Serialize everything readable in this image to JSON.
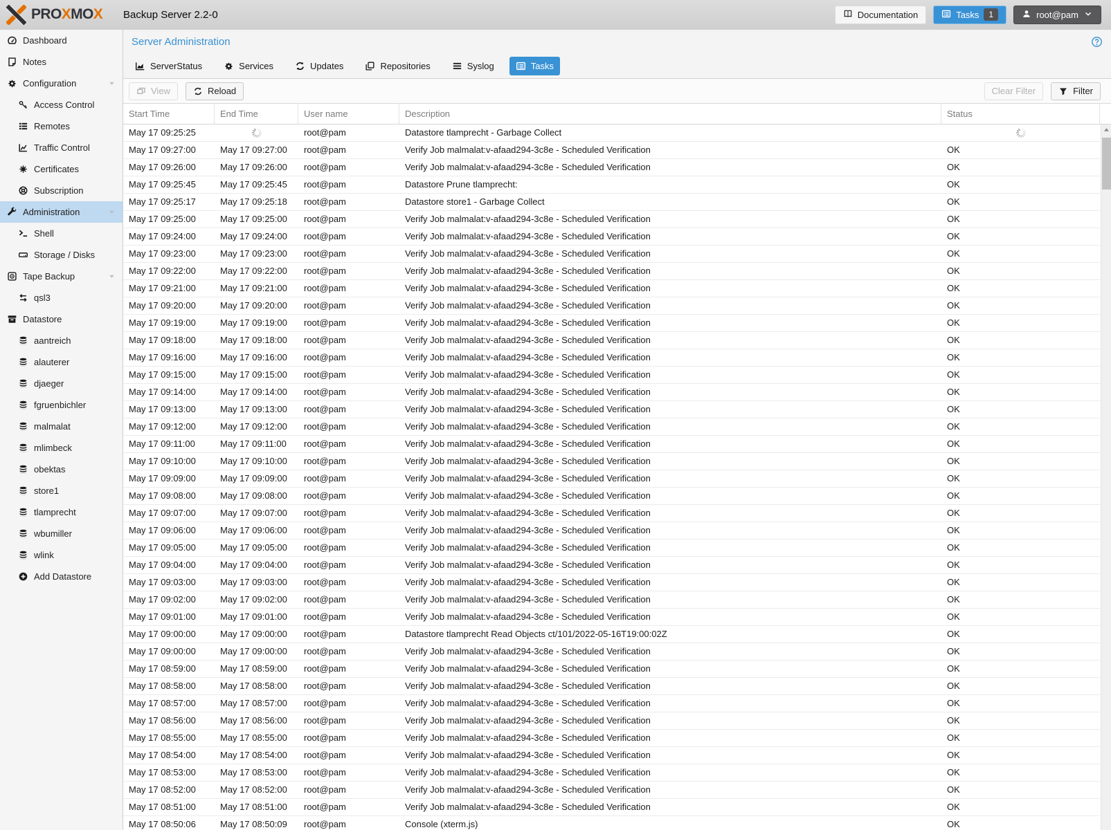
{
  "topbar": {
    "brand_segments": [
      {
        "text": "PRO",
        "color": "dark"
      },
      {
        "text": "X",
        "color": "orange"
      },
      {
        "text": "MO",
        "color": "dark"
      },
      {
        "text": "X",
        "color": "orange"
      }
    ],
    "product_title": "Backup Server 2.2-0",
    "documentation_label": "Documentation",
    "documentation_icon": "book-icon",
    "tasks_label": "Tasks",
    "tasks_icon": "list-alt-icon",
    "tasks_badge": "1",
    "user_label": "root@pam",
    "user_icon": "user-icon",
    "user_caret_icon": "chevron-down-icon",
    "colors": {
      "accent_blue": "#3892d4",
      "brand_orange": "#e57000"
    }
  },
  "sidebar": {
    "items": [
      {
        "label": "Dashboard",
        "icon": "dashboard-icon",
        "level": 0
      },
      {
        "label": "Notes",
        "icon": "note-icon",
        "level": 0
      },
      {
        "label": "Configuration",
        "icon": "gears-icon",
        "level": 0,
        "expandable": true
      },
      {
        "label": "Access Control",
        "icon": "key-icon",
        "level": 1
      },
      {
        "label": "Remotes",
        "icon": "remotes-icon",
        "level": 1
      },
      {
        "label": "Traffic Control",
        "icon": "traffic-chart-icon",
        "level": 1
      },
      {
        "label": "Certificates",
        "icon": "certificate-icon",
        "level": 1
      },
      {
        "label": "Subscription",
        "icon": "support-icon",
        "level": 1
      },
      {
        "label": "Administration",
        "icon": "wrench-icon",
        "level": 0,
        "expandable": true,
        "selected": true
      },
      {
        "label": "Shell",
        "icon": "terminal-icon",
        "level": 1
      },
      {
        "label": "Storage / Disks",
        "icon": "hdd-icon",
        "level": 1
      },
      {
        "label": "Tape Backup",
        "icon": "tape-icon",
        "level": 0,
        "expandable": true
      },
      {
        "label": "qsl3",
        "icon": "exchange-icon",
        "level": 1
      },
      {
        "label": "Datastore",
        "icon": "datastore-icon",
        "level": 0
      },
      {
        "label": "aantreich",
        "icon": "database-icon",
        "level": 1
      },
      {
        "label": "alauterer",
        "icon": "database-icon",
        "level": 1
      },
      {
        "label": "djaeger",
        "icon": "database-icon",
        "level": 1
      },
      {
        "label": "fgruenbichler",
        "icon": "database-icon",
        "level": 1
      },
      {
        "label": "malmalat",
        "icon": "database-icon",
        "level": 1
      },
      {
        "label": "mlimbeck",
        "icon": "database-icon",
        "level": 1
      },
      {
        "label": "obektas",
        "icon": "database-icon",
        "level": 1
      },
      {
        "label": "store1",
        "icon": "database-icon",
        "level": 1
      },
      {
        "label": "tlamprecht",
        "icon": "database-icon",
        "level": 1
      },
      {
        "label": "wbumiller",
        "icon": "database-icon",
        "level": 1
      },
      {
        "label": "wlink",
        "icon": "database-icon",
        "level": 1
      },
      {
        "label": "Add Datastore",
        "icon": "plus-circle-icon",
        "level": 1
      }
    ]
  },
  "content": {
    "title": "Server Administration",
    "help_icon": "question-circle-icon",
    "tabs": [
      {
        "label": "ServerStatus",
        "icon": "chart-area-icon",
        "active": false
      },
      {
        "label": "Services",
        "icon": "gears-icon",
        "active": false
      },
      {
        "label": "Updates",
        "icon": "refresh-icon",
        "active": false
      },
      {
        "label": "Repositories",
        "icon": "copy-icon",
        "active": false
      },
      {
        "label": "Syslog",
        "icon": "list-icon",
        "active": false
      },
      {
        "label": "Tasks",
        "icon": "list-alt-icon",
        "active": true
      }
    ],
    "toolbar": {
      "view_label": "View",
      "view_icon": "window-icon",
      "view_disabled": true,
      "reload_label": "Reload",
      "reload_icon": "refresh-icon",
      "clear_filter_label": "Clear Filter",
      "clear_filter_disabled": true,
      "filter_label": "Filter",
      "filter_icon": "filter-icon"
    },
    "table": {
      "columns": [
        "Start Time",
        "End Time",
        "User name",
        "Description",
        "Status"
      ],
      "rows": [
        {
          "start": "May 17 09:25:25",
          "end": "",
          "user": "root@pam",
          "desc": "Datastore tlamprecht - Garbage Collect",
          "status": "",
          "loading": true
        },
        {
          "start": "May 17 09:27:00",
          "end": "May 17 09:27:00",
          "user": "root@pam",
          "desc": "Verify Job malmalat:v-afaad294-3c8e - Scheduled Verification",
          "status": "OK"
        },
        {
          "start": "May 17 09:26:00",
          "end": "May 17 09:26:00",
          "user": "root@pam",
          "desc": "Verify Job malmalat:v-afaad294-3c8e - Scheduled Verification",
          "status": "OK"
        },
        {
          "start": "May 17 09:25:45",
          "end": "May 17 09:25:45",
          "user": "root@pam",
          "desc": "Datastore Prune tlamprecht:",
          "status": "OK"
        },
        {
          "start": "May 17 09:25:17",
          "end": "May 17 09:25:18",
          "user": "root@pam",
          "desc": "Datastore store1 - Garbage Collect",
          "status": "OK"
        },
        {
          "start": "May 17 09:25:00",
          "end": "May 17 09:25:00",
          "user": "root@pam",
          "desc": "Verify Job malmalat:v-afaad294-3c8e - Scheduled Verification",
          "status": "OK"
        },
        {
          "start": "May 17 09:24:00",
          "end": "May 17 09:24:00",
          "user": "root@pam",
          "desc": "Verify Job malmalat:v-afaad294-3c8e - Scheduled Verification",
          "status": "OK"
        },
        {
          "start": "May 17 09:23:00",
          "end": "May 17 09:23:00",
          "user": "root@pam",
          "desc": "Verify Job malmalat:v-afaad294-3c8e - Scheduled Verification",
          "status": "OK"
        },
        {
          "start": "May 17 09:22:00",
          "end": "May 17 09:22:00",
          "user": "root@pam",
          "desc": "Verify Job malmalat:v-afaad294-3c8e - Scheduled Verification",
          "status": "OK"
        },
        {
          "start": "May 17 09:21:00",
          "end": "May 17 09:21:00",
          "user": "root@pam",
          "desc": "Verify Job malmalat:v-afaad294-3c8e - Scheduled Verification",
          "status": "OK"
        },
        {
          "start": "May 17 09:20:00",
          "end": "May 17 09:20:00",
          "user": "root@pam",
          "desc": "Verify Job malmalat:v-afaad294-3c8e - Scheduled Verification",
          "status": "OK"
        },
        {
          "start": "May 17 09:19:00",
          "end": "May 17 09:19:00",
          "user": "root@pam",
          "desc": "Verify Job malmalat:v-afaad294-3c8e - Scheduled Verification",
          "status": "OK"
        },
        {
          "start": "May 17 09:18:00",
          "end": "May 17 09:18:00",
          "user": "root@pam",
          "desc": "Verify Job malmalat:v-afaad294-3c8e - Scheduled Verification",
          "status": "OK"
        },
        {
          "start": "May 17 09:16:00",
          "end": "May 17 09:16:00",
          "user": "root@pam",
          "desc": "Verify Job malmalat:v-afaad294-3c8e - Scheduled Verification",
          "status": "OK"
        },
        {
          "start": "May 17 09:15:00",
          "end": "May 17 09:15:00",
          "user": "root@pam",
          "desc": "Verify Job malmalat:v-afaad294-3c8e - Scheduled Verification",
          "status": "OK"
        },
        {
          "start": "May 17 09:14:00",
          "end": "May 17 09:14:00",
          "user": "root@pam",
          "desc": "Verify Job malmalat:v-afaad294-3c8e - Scheduled Verification",
          "status": "OK"
        },
        {
          "start": "May 17 09:13:00",
          "end": "May 17 09:13:00",
          "user": "root@pam",
          "desc": "Verify Job malmalat:v-afaad294-3c8e - Scheduled Verification",
          "status": "OK"
        },
        {
          "start": "May 17 09:12:00",
          "end": "May 17 09:12:00",
          "user": "root@pam",
          "desc": "Verify Job malmalat:v-afaad294-3c8e - Scheduled Verification",
          "status": "OK"
        },
        {
          "start": "May 17 09:11:00",
          "end": "May 17 09:11:00",
          "user": "root@pam",
          "desc": "Verify Job malmalat:v-afaad294-3c8e - Scheduled Verification",
          "status": "OK"
        },
        {
          "start": "May 17 09:10:00",
          "end": "May 17 09:10:00",
          "user": "root@pam",
          "desc": "Verify Job malmalat:v-afaad294-3c8e - Scheduled Verification",
          "status": "OK"
        },
        {
          "start": "May 17 09:09:00",
          "end": "May 17 09:09:00",
          "user": "root@pam",
          "desc": "Verify Job malmalat:v-afaad294-3c8e - Scheduled Verification",
          "status": "OK"
        },
        {
          "start": "May 17 09:08:00",
          "end": "May 17 09:08:00",
          "user": "root@pam",
          "desc": "Verify Job malmalat:v-afaad294-3c8e - Scheduled Verification",
          "status": "OK"
        },
        {
          "start": "May 17 09:07:00",
          "end": "May 17 09:07:00",
          "user": "root@pam",
          "desc": "Verify Job malmalat:v-afaad294-3c8e - Scheduled Verification",
          "status": "OK"
        },
        {
          "start": "May 17 09:06:00",
          "end": "May 17 09:06:00",
          "user": "root@pam",
          "desc": "Verify Job malmalat:v-afaad294-3c8e - Scheduled Verification",
          "status": "OK"
        },
        {
          "start": "May 17 09:05:00",
          "end": "May 17 09:05:00",
          "user": "root@pam",
          "desc": "Verify Job malmalat:v-afaad294-3c8e - Scheduled Verification",
          "status": "OK"
        },
        {
          "start": "May 17 09:04:00",
          "end": "May 17 09:04:00",
          "user": "root@pam",
          "desc": "Verify Job malmalat:v-afaad294-3c8e - Scheduled Verification",
          "status": "OK"
        },
        {
          "start": "May 17 09:03:00",
          "end": "May 17 09:03:00",
          "user": "root@pam",
          "desc": "Verify Job malmalat:v-afaad294-3c8e - Scheduled Verification",
          "status": "OK"
        },
        {
          "start": "May 17 09:02:00",
          "end": "May 17 09:02:00",
          "user": "root@pam",
          "desc": "Verify Job malmalat:v-afaad294-3c8e - Scheduled Verification",
          "status": "OK"
        },
        {
          "start": "May 17 09:01:00",
          "end": "May 17 09:01:00",
          "user": "root@pam",
          "desc": "Verify Job malmalat:v-afaad294-3c8e - Scheduled Verification",
          "status": "OK"
        },
        {
          "start": "May 17 09:00:00",
          "end": "May 17 09:00:00",
          "user": "root@pam",
          "desc": "Datastore tlamprecht Read Objects ct/101/2022-05-16T19:00:02Z",
          "status": "OK"
        },
        {
          "start": "May 17 09:00:00",
          "end": "May 17 09:00:00",
          "user": "root@pam",
          "desc": "Verify Job malmalat:v-afaad294-3c8e - Scheduled Verification",
          "status": "OK"
        },
        {
          "start": "May 17 08:59:00",
          "end": "May 17 08:59:00",
          "user": "root@pam",
          "desc": "Verify Job malmalat:v-afaad294-3c8e - Scheduled Verification",
          "status": "OK"
        },
        {
          "start": "May 17 08:58:00",
          "end": "May 17 08:58:00",
          "user": "root@pam",
          "desc": "Verify Job malmalat:v-afaad294-3c8e - Scheduled Verification",
          "status": "OK"
        },
        {
          "start": "May 17 08:57:00",
          "end": "May 17 08:57:00",
          "user": "root@pam",
          "desc": "Verify Job malmalat:v-afaad294-3c8e - Scheduled Verification",
          "status": "OK"
        },
        {
          "start": "May 17 08:56:00",
          "end": "May 17 08:56:00",
          "user": "root@pam",
          "desc": "Verify Job malmalat:v-afaad294-3c8e - Scheduled Verification",
          "status": "OK"
        },
        {
          "start": "May 17 08:55:00",
          "end": "May 17 08:55:00",
          "user": "root@pam",
          "desc": "Verify Job malmalat:v-afaad294-3c8e - Scheduled Verification",
          "status": "OK"
        },
        {
          "start": "May 17 08:54:00",
          "end": "May 17 08:54:00",
          "user": "root@pam",
          "desc": "Verify Job malmalat:v-afaad294-3c8e - Scheduled Verification",
          "status": "OK"
        },
        {
          "start": "May 17 08:53:00",
          "end": "May 17 08:53:00",
          "user": "root@pam",
          "desc": "Verify Job malmalat:v-afaad294-3c8e - Scheduled Verification",
          "status": "OK"
        },
        {
          "start": "May 17 08:52:00",
          "end": "May 17 08:52:00",
          "user": "root@pam",
          "desc": "Verify Job malmalat:v-afaad294-3c8e - Scheduled Verification",
          "status": "OK"
        },
        {
          "start": "May 17 08:51:00",
          "end": "May 17 08:51:00",
          "user": "root@pam",
          "desc": "Verify Job malmalat:v-afaad294-3c8e - Scheduled Verification",
          "status": "OK"
        },
        {
          "start": "May 17 08:50:06",
          "end": "May 17 08:50:09",
          "user": "root@pam",
          "desc": "Console (xterm.js)",
          "status": "OK"
        }
      ]
    }
  }
}
